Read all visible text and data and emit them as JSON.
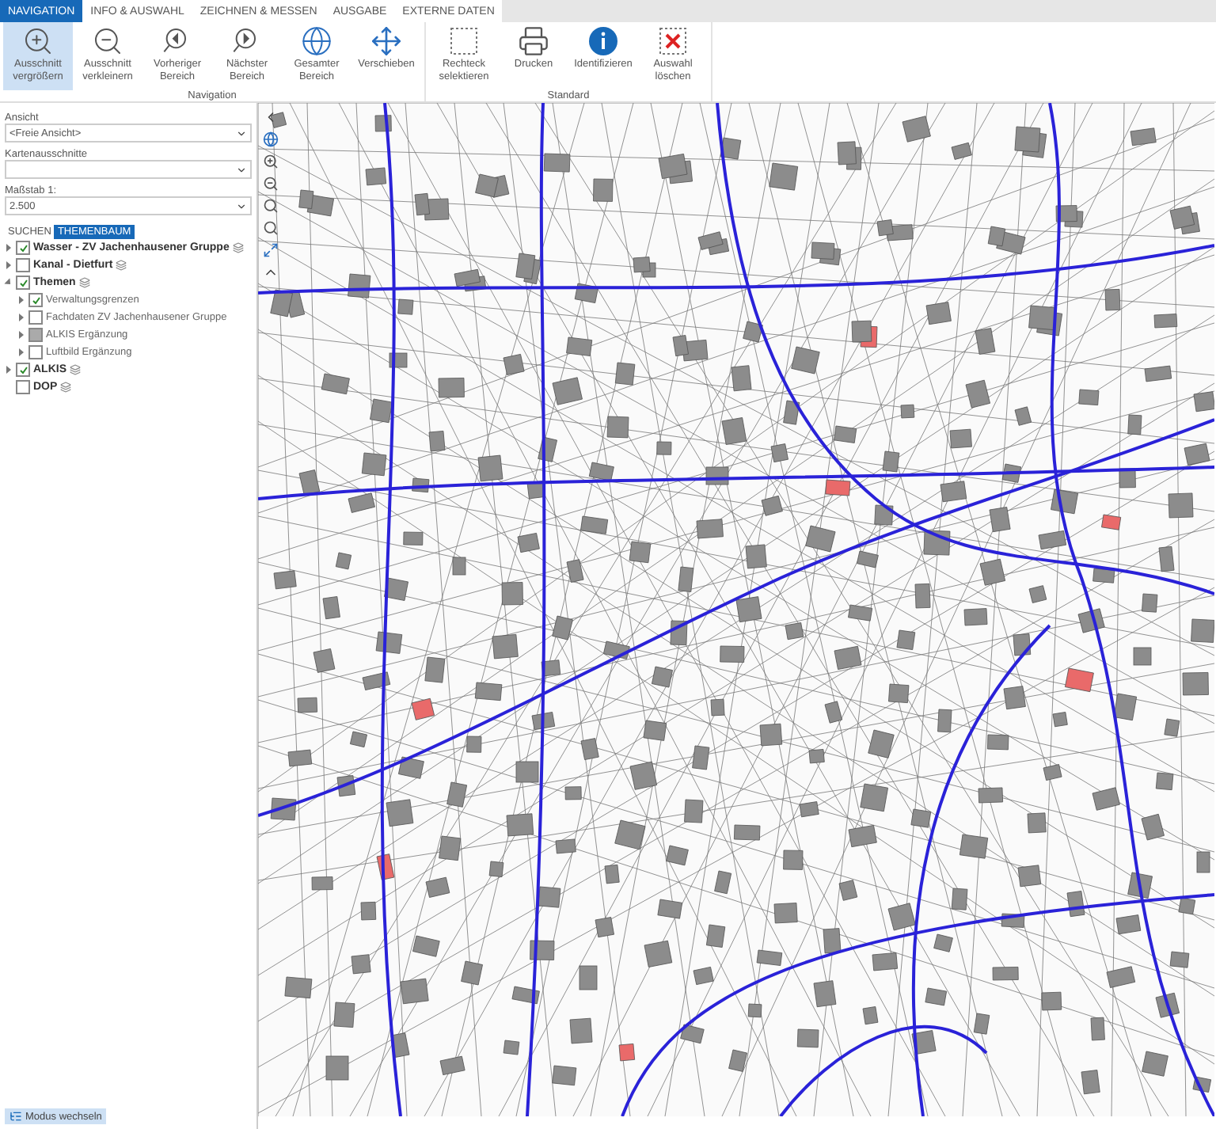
{
  "tabs": [
    {
      "label": "NAVIGATION",
      "selected": true
    },
    {
      "label": "INFO & AUSWAHL",
      "selected": false
    },
    {
      "label": "ZEICHNEN & MESSEN",
      "selected": false
    },
    {
      "label": "AUSGABE",
      "selected": false
    },
    {
      "label": "EXTERNE DATEN",
      "selected": false
    }
  ],
  "ribbon_groups": [
    {
      "label": "Navigation",
      "buttons": [
        {
          "kind": "zoomin",
          "label": "Ausschnitt\nvergrößern",
          "selected": true
        },
        {
          "kind": "zoomout",
          "label": "Ausschnitt\nverkleinern",
          "selected": false
        },
        {
          "kind": "previous",
          "label": "Vorheriger\nBereich",
          "selected": false
        },
        {
          "kind": "next",
          "label": "Nächster\nBereich",
          "selected": false
        },
        {
          "kind": "extent",
          "label": "Gesamter\nBereich",
          "selected": false
        },
        {
          "kind": "pan",
          "label": "Verschieben",
          "selected": false
        }
      ]
    },
    {
      "label": "Standard",
      "buttons": [
        {
          "kind": "select",
          "label": "Rechteck\nselektieren",
          "selected": false
        },
        {
          "kind": "print",
          "label": "Drucken",
          "selected": false
        },
        {
          "kind": "identify",
          "label": "Identifizieren",
          "selected": false
        },
        {
          "kind": "clear",
          "label": "Auswahl\nlöschen",
          "selected": false
        }
      ]
    }
  ],
  "selects": [
    {
      "label": "Ansicht",
      "value": "<Freie Ansicht>"
    },
    {
      "label": "Kartenausschnitte"
    },
    {
      "label": "Maßstab 1:",
      "value": "2.500"
    }
  ],
  "panel_tabs": [
    {
      "label": "SUCHEN",
      "selected": false
    },
    {
      "label": "THEMENBAUM",
      "selected": true
    }
  ],
  "tree": [
    {
      "label": "Wasser - ZV Jachenhausener Gruppe",
      "checked": true,
      "expanded": false
    },
    {
      "label": "Kanal - Dietfurt",
      "checked": false,
      "expanded": false
    },
    {
      "label": "Themen",
      "checked": true,
      "expanded": true,
      "children": [
        {
          "label": "Verwaltungsgrenzen",
          "checked": true,
          "expanded": false
        },
        {
          "label": "Fachdaten ZV Jachenhausener Gruppe",
          "checked": false,
          "expanded": false
        },
        {
          "label": "ALKIS Ergänzung",
          "checked": false,
          "greyed": true,
          "expanded": false
        },
        {
          "label": "Luftbild Ergänzung",
          "checked": false,
          "expanded": false
        }
      ]
    },
    {
      "label": "ALKIS",
      "checked": true,
      "expanded": false
    },
    {
      "label": "DOP",
      "checked": false
    }
  ],
  "mode_button": {
    "label": "Modus wechseln"
  }
}
